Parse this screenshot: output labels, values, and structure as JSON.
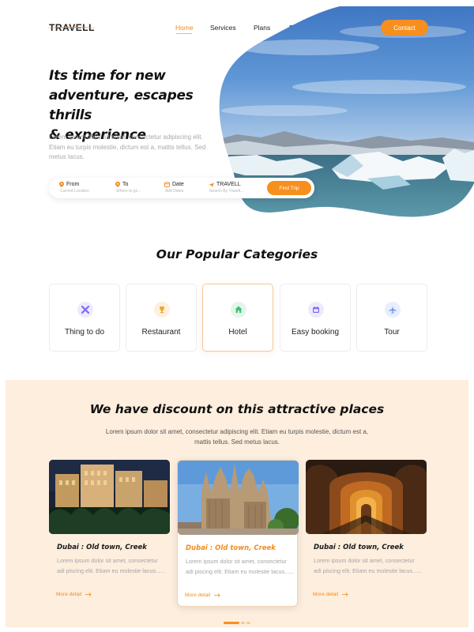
{
  "header": {
    "logo": "TRAVELL",
    "nav": [
      {
        "label": "Home",
        "active": true
      },
      {
        "label": "Services",
        "active": false
      },
      {
        "label": "Plans",
        "active": false
      },
      {
        "label": "Blog",
        "active": false
      }
    ],
    "contact_label": "Contact"
  },
  "hero": {
    "title_lines": [
      "Its time for new",
      "adventure, escapes thrills",
      "& experience"
    ],
    "description": "Lorem ipsum dolor sit amet, consectetur adipiscing elit. Etiam eu turpis molestie, dictum est a, mattis tellus. Sed  metus  lacus.",
    "search": {
      "from": {
        "label": "From",
        "placeholder": "Current Location"
      },
      "to": {
        "label": "To",
        "placeholder": "Where to go..."
      },
      "date": {
        "label": "Date",
        "placeholder": "Add Dates"
      },
      "travell": {
        "label": "TRAVELL",
        "placeholder": "Search By Travell..."
      },
      "button": "Find Trip"
    }
  },
  "categories": {
    "title": "Our Popular Categories",
    "items": [
      {
        "label": "Thing to do",
        "icon": "tools-icon",
        "color": "#7b6cf0",
        "bg": "#eeeafd",
        "active": false
      },
      {
        "label": "Restaurant",
        "icon": "trophy-icon",
        "color": "#f0a531",
        "bg": "#fdf1dd",
        "active": false
      },
      {
        "label": "Hotel",
        "icon": "home-icon",
        "color": "#3cc27a",
        "bg": "#e2f6ea",
        "active": true
      },
      {
        "label": "Easy booking",
        "icon": "calendar-icon",
        "color": "#7b6cf0",
        "bg": "#eeeafd",
        "active": false
      },
      {
        "label": "Tour",
        "icon": "plane-icon",
        "color": "#6b8ff5",
        "bg": "#e8eefd",
        "active": false
      }
    ]
  },
  "discount": {
    "title": "We have discount on this attractive places",
    "description": "Lorem ipsum dolor sit amet, consectetur adipiscing elit. Etiam eu turpis molestie, dictum est a, mattis tellus. Sed  metus  lacus.",
    "cards": [
      {
        "title": "Dubai : Old town, Creek",
        "text": "Lorem ipsum dolor sit amet, consectetur adi piscing elit. Etiam eu molestie lacus......",
        "link": "More detail",
        "active": false
      },
      {
        "title": "Dubai : Old town, Creek",
        "text": "Lorem ipsum dolor sit amet, consectetur adi piscing elit. Etiam eu molestie lacus......",
        "link": "More detail",
        "active": true
      },
      {
        "title": "Dubai : Old town, Creek",
        "text": "Lorem ipsum dolor sit amet, consectetur adi piscing elit. Etiam eu molestie lacus......",
        "link": "More detail",
        "active": false
      }
    ],
    "pagination": {
      "pages": 3,
      "current": 1
    }
  },
  "colors": {
    "accent": "#f78f1e",
    "discount_bg": "#fdeede"
  }
}
